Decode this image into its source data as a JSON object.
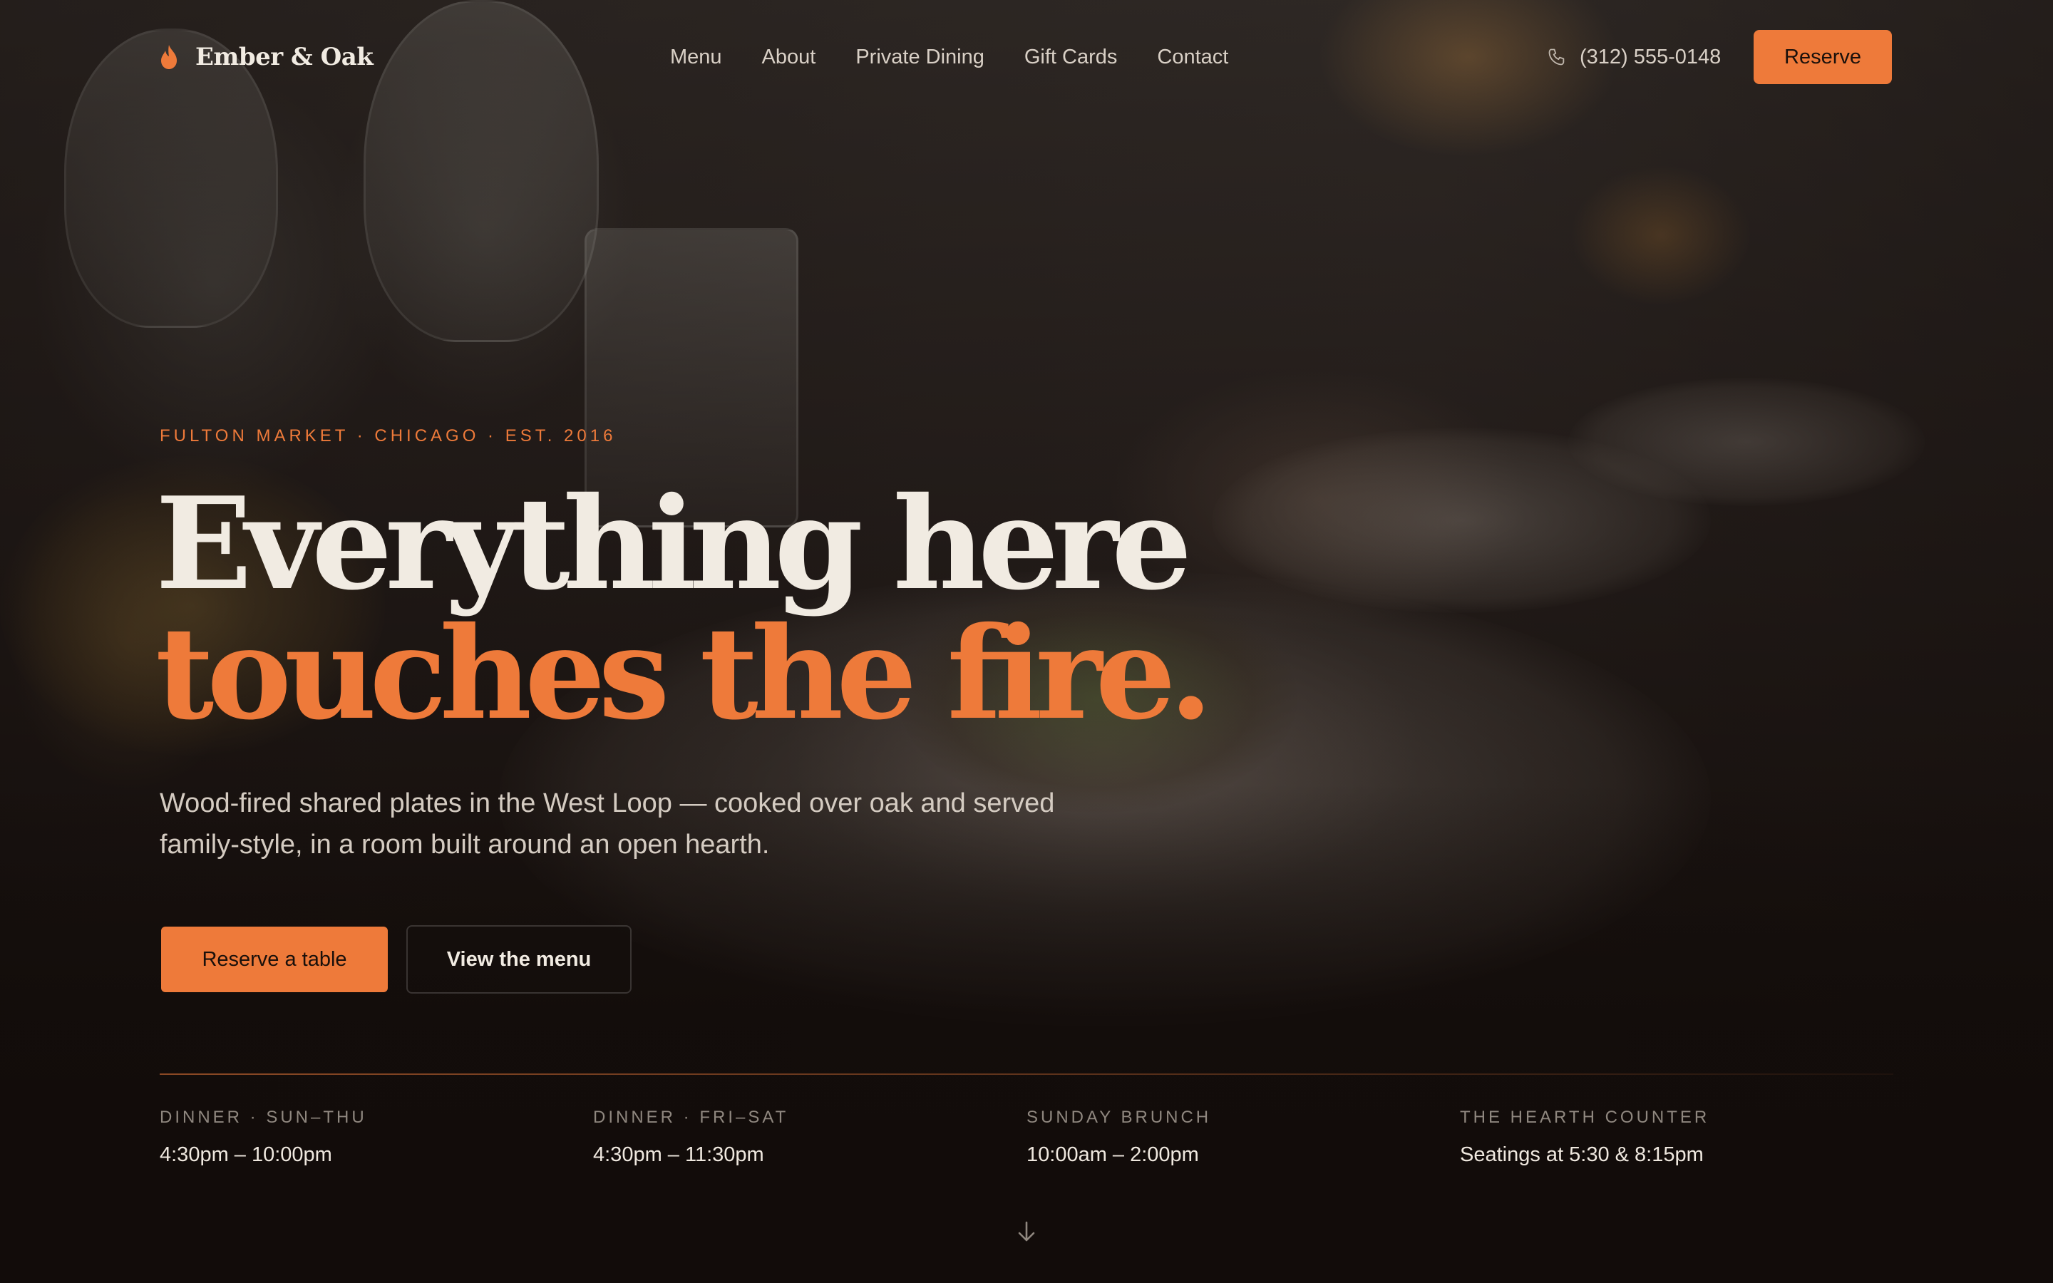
{
  "brand": {
    "name": "Ember & Oak",
    "accent": "#ee7a3a",
    "logo_icon": "flame-icon"
  },
  "nav": {
    "links": [
      "Menu",
      "About",
      "Private Dining",
      "Gift Cards",
      "Contact"
    ],
    "phone_icon": "phone-icon",
    "phone": "(312) 555-0148",
    "reserve_label": "Reserve"
  },
  "hero": {
    "eyebrow": "FULTON MARKET · CHICAGO · EST. 2016",
    "headline_line1": "Everything here",
    "headline_line2": "touches the fire.",
    "lede": "Wood-fired shared plates in the West Loop — cooked over oak and served family-style, in a room built around an open hearth.",
    "primary_cta": "Reserve a table",
    "secondary_cta": "View the menu"
  },
  "hours": [
    {
      "label": "DINNER · SUN–THU",
      "value": "4:30pm – 10:00pm"
    },
    {
      "label": "DINNER · FRI–SAT",
      "value": "4:30pm – 11:30pm"
    },
    {
      "label": "SUNDAY BRUNCH",
      "value": "10:00am – 2:00pm"
    },
    {
      "label": "THE HEARTH COUNTER",
      "value": "Seatings at 5:30 & 8:15pm"
    }
  ],
  "scroll_icon": "arrow-down-icon"
}
